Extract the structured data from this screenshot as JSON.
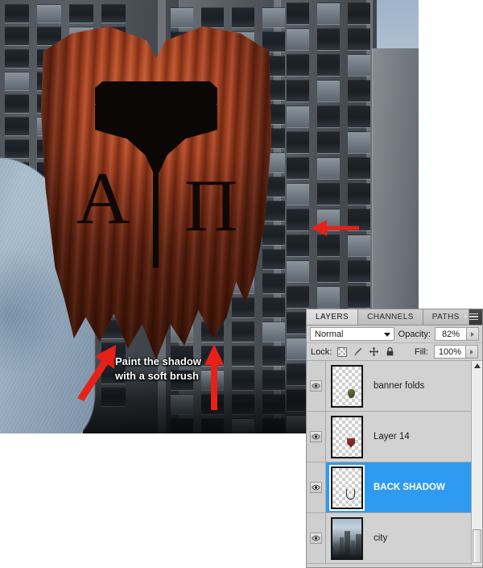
{
  "app": "Adobe Photoshop",
  "panel": {
    "tabs": [
      {
        "label": "LAYERS",
        "active": true
      },
      {
        "label": "CHANNELS",
        "active": false
      },
      {
        "label": "PATHS",
        "active": false
      }
    ],
    "menu_icon": "panel-menu-icon",
    "blend_mode": {
      "value": "Normal",
      "caret_icon": "chevron-down-icon"
    },
    "opacity": {
      "label": "Opacity:",
      "value": "82%",
      "spinner_icon": "spinner-arrow-icon"
    },
    "fill": {
      "label": "Fill:",
      "value": "100%",
      "spinner_icon": "spinner-arrow-icon"
    },
    "lock": {
      "label": "Lock:",
      "icons": [
        "lock-transparent-pixels-icon",
        "lock-image-pixels-icon",
        "lock-position-icon",
        "lock-all-icon"
      ]
    },
    "layers": [
      {
        "name": "banner folds",
        "visible": true,
        "selected": false,
        "eye_icon": "eye-icon",
        "thumb": "transparent-fold"
      },
      {
        "name": "Layer 14",
        "visible": true,
        "selected": false,
        "eye_icon": "eye-icon",
        "thumb": "transparent-shield"
      },
      {
        "name": "BACK SHADOW",
        "visible": true,
        "selected": true,
        "eye_icon": "eye-icon",
        "thumb": "transparent-outline"
      },
      {
        "name": "city",
        "visible": true,
        "selected": false,
        "eye_icon": "eye-icon",
        "thumb": "city-photo"
      }
    ],
    "scrollbar": {
      "up_icon": "scroll-up-arrow-icon"
    },
    "colors": {
      "selection": "#2e9bf0",
      "panel_bg": "#d2d2d2",
      "tabstrip_bg": "#3c3c3c"
    }
  },
  "canvas": {
    "annotation": {
      "text": "Paint the shadow with a soft brush",
      "color": "#ffffff"
    },
    "arrows": [
      {
        "name": "arrow-right-banner-edge",
        "direction": "left",
        "color": "#e8201a"
      },
      {
        "name": "arrow-up-left-shadow",
        "direction": "up-right",
        "color": "#e8201a"
      },
      {
        "name": "arrow-up-right-shadow",
        "direction": "up",
        "color": "#e8201a"
      }
    ],
    "emblem": {
      "letter_left": "A",
      "letter_right": "Π",
      "symbol": "axe-head"
    }
  }
}
